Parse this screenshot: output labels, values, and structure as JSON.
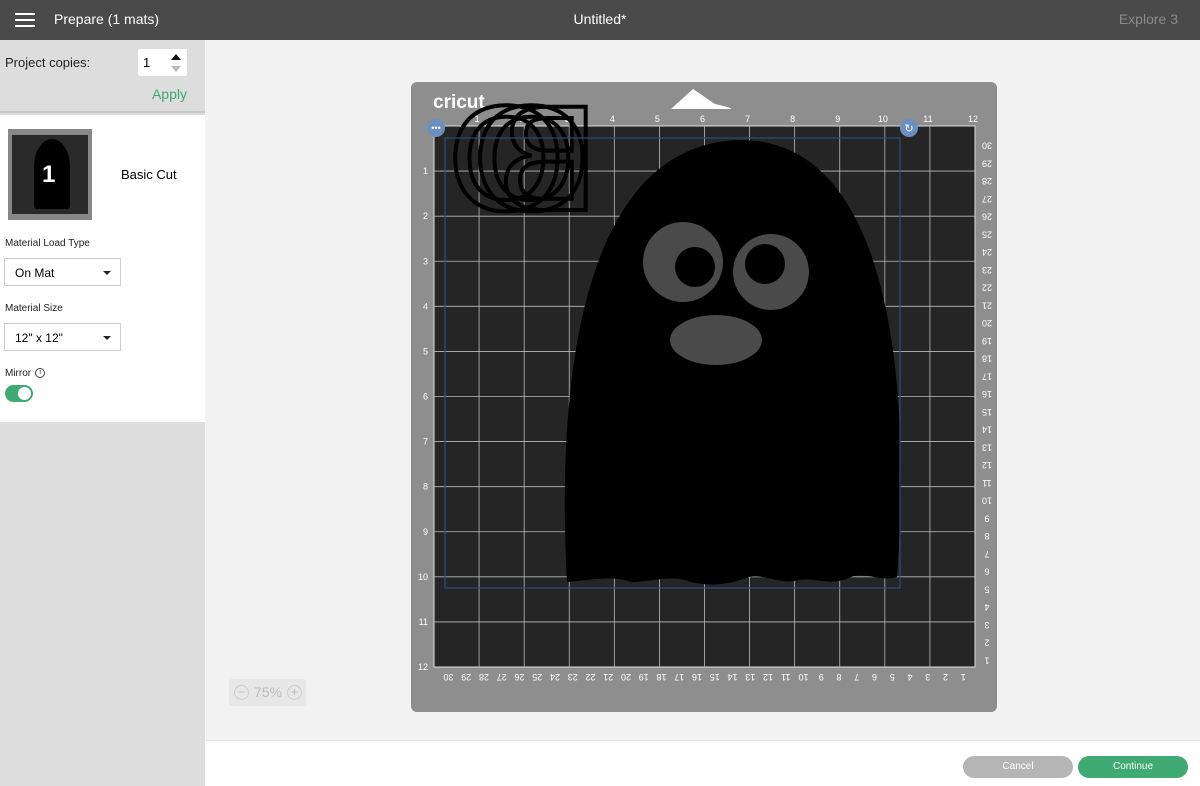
{
  "topbar": {
    "prepare": "Prepare (1 mats)",
    "title": "Untitled*",
    "machine": "Explore 3"
  },
  "sidebar": {
    "copies_label": "Project copies:",
    "copies_value": "1",
    "apply": "Apply",
    "mat_number": "1",
    "mat_mode": "Basic Cut",
    "load_type_label": "Material Load Type",
    "load_type_value": "On Mat",
    "size_label": "Material Size",
    "size_value": "12\" x 12\"",
    "mirror_label": "Mirror",
    "mirror_on": true
  },
  "mat": {
    "brand": "cricut",
    "design_text": "BOO",
    "inch_labels": [
      "1",
      "2",
      "3",
      "4",
      "5",
      "6",
      "7",
      "8",
      "9",
      "10",
      "11",
      "12"
    ],
    "cm_count": 30
  },
  "zoom": {
    "value": "75%",
    "minus": "−",
    "plus": "+"
  },
  "footer": {
    "cancel": "Cancel",
    "continue": "Continue"
  },
  "colors": {
    "accent": "#3faa72",
    "topbar": "#4a4a4a",
    "mat": "#8e8e8e",
    "grid": "#252525",
    "selection": "#2d4a80"
  }
}
